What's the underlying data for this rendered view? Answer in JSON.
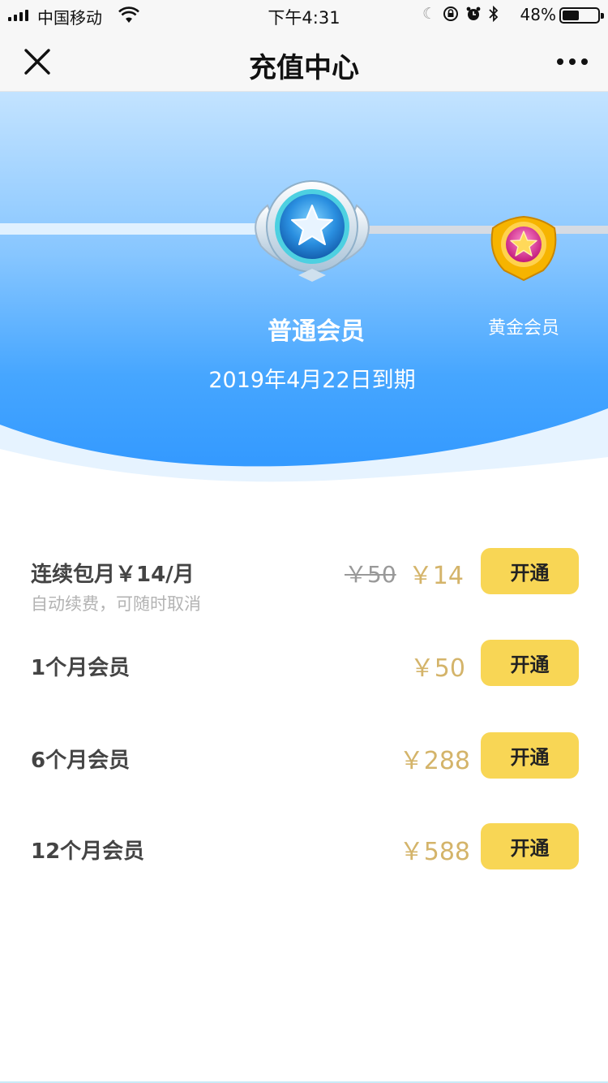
{
  "status_bar": {
    "carrier": "中国移动",
    "time": "下午4:31",
    "battery": "48%",
    "battery_level": 0.48,
    "icons": [
      "signal-icon",
      "wifi-icon",
      "moon-icon",
      "rotation-lock-icon",
      "alarm-icon",
      "bluetooth-icon",
      "battery-icon"
    ]
  },
  "nav": {
    "title": "充值中心",
    "close_icon": "close-icon",
    "more_icon": "more-icon"
  },
  "banner": {
    "current_tier": "普通会员",
    "next_tier": "黄金会员",
    "expiry": "2019年4月22日到期",
    "colors": {
      "top": "#c3e3ff",
      "bottom": "#2d95ff"
    }
  },
  "plans": [
    {
      "name": "连续包月￥14/月",
      "subtitle": "自动续费，可随时取消",
      "old_price": "￥50",
      "price": "￥14",
      "button": "开通"
    },
    {
      "name": "1个月会员",
      "price": "￥50",
      "button": "开通"
    },
    {
      "name": "6个月会员",
      "price": "￥288",
      "button": "开通"
    },
    {
      "name": "12个月会员",
      "price": "￥588",
      "button": "开通"
    }
  ],
  "colors": {
    "button": "#f8d655",
    "price": "#d4b46a",
    "plan_text": "#444444",
    "subtitle": "#b3b3b3"
  }
}
